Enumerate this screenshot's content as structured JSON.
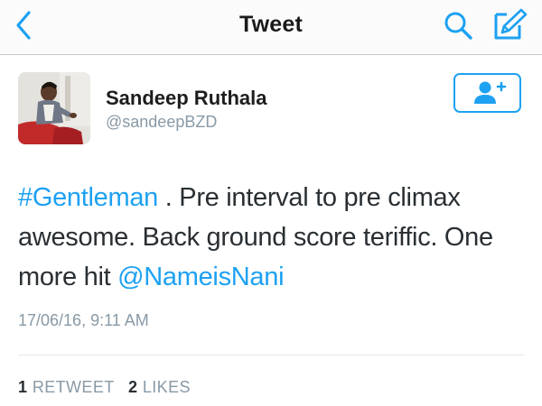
{
  "navbar": {
    "title": "Tweet",
    "back_icon": "chevron-left-icon",
    "search_icon": "search-icon",
    "compose_icon": "compose-icon",
    "accent": "#1da1f2"
  },
  "user": {
    "name": "Sandeep Ruthala",
    "handle": "@sandeepBZD",
    "follow_icon": "add-user-icon"
  },
  "tweet": {
    "hashtag": "#Gentleman",
    "text_part1": " . Pre interval to pre climax awesome. Back ground score teriffic. One more hit ",
    "mention": "@NameisNani",
    "timestamp": "17/06/16, 9:11 AM"
  },
  "stats": {
    "retweets_count": "1",
    "retweets_label": "RETWEET",
    "likes_count": "2",
    "likes_label": "LIKES"
  },
  "colors": {
    "link": "#1da1f2",
    "secondary_text": "#8899a6",
    "primary_text": "#292f33"
  }
}
